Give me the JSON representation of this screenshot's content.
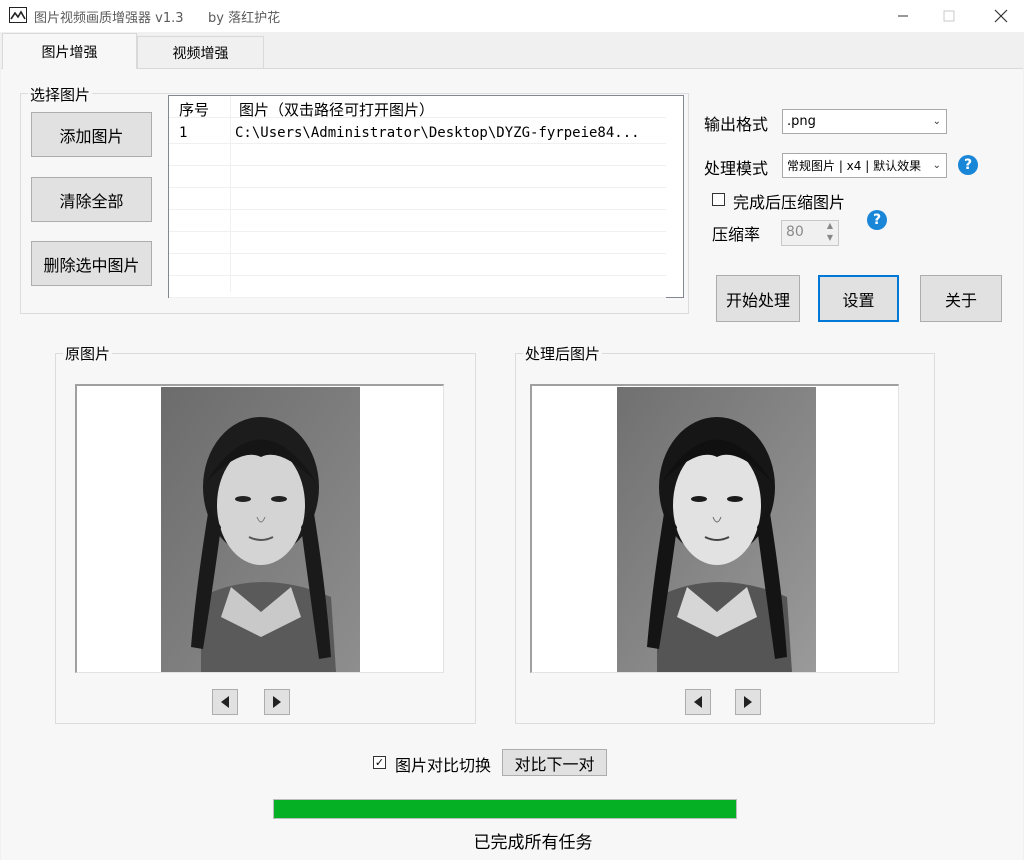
{
  "window": {
    "title": "图片视频画质增强器 v1.3",
    "author": "by 落红护花",
    "minimize_icon": "minimize-icon",
    "maximize_icon": "maximize-icon",
    "close_icon": "close-icon"
  },
  "tabs": [
    {
      "label": "图片增强",
      "active": true
    },
    {
      "label": "视频增强",
      "active": false
    }
  ],
  "select_group": {
    "title": "选择图片",
    "add_button": "添加图片",
    "clear_button": "清除全部",
    "delete_button": "删除选中图片"
  },
  "file_list": {
    "columns": [
      "序号",
      "图片（双击路径可打开图片）"
    ],
    "rows": [
      {
        "index": "1",
        "path": "C:\\Users\\Administrator\\Desktop\\DYZG-fyrpeie84..."
      }
    ]
  },
  "settings": {
    "output_format_label": "输出格式",
    "output_format_value": ".png",
    "mode_label": "处理模式",
    "mode_value": "常规图片 | x4 | 默认效果",
    "compress_checkbox_label": "完成后压缩图片",
    "compress_checked": false,
    "ratio_label": "压缩率",
    "ratio_value": "80",
    "help_symbol": "?"
  },
  "actions": {
    "start_button": "开始处理",
    "settings_button": "设置",
    "about_button": "关于"
  },
  "preview": {
    "original_title": "原图片",
    "processed_title": "处理后图片",
    "prev_icon": "triangle-left-icon",
    "next_icon": "triangle-right-icon"
  },
  "compare": {
    "checkbox_label": "图片对比切换",
    "checked": true,
    "next_pair_button": "对比下一对"
  },
  "progress": {
    "percent": 100,
    "status": "已完成所有任务",
    "color": "#06b025"
  }
}
